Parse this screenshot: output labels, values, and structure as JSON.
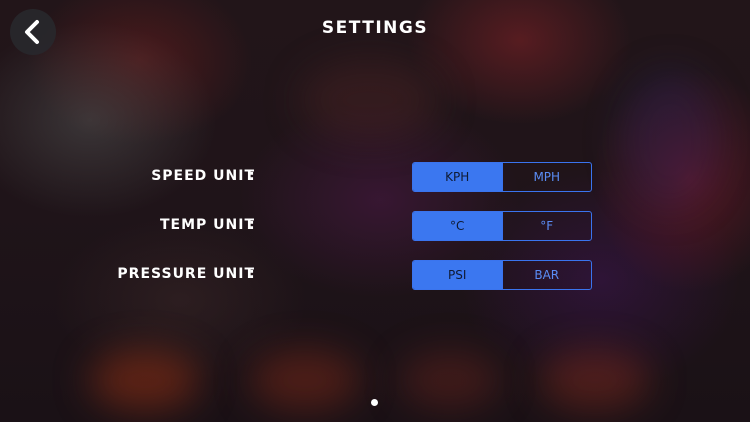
{
  "header": {
    "title": "SETTINGS",
    "back_icon": "chevron-left-icon"
  },
  "settings": {
    "colon": ":",
    "speed": {
      "label": "SPEED UNIT",
      "options": [
        "KPH",
        "MPH"
      ],
      "selected": "KPH"
    },
    "temp": {
      "label": "TEMP UNIT",
      "options": [
        "°C",
        "°F"
      ],
      "selected": "°C"
    },
    "pressure": {
      "label": "PRESSURE UNIT",
      "options": [
        "PSI",
        "BAR"
      ],
      "selected": "PSI"
    }
  },
  "pager": {
    "current_page": 1,
    "page_count": 1
  },
  "colors": {
    "accent": "#3b77f0",
    "accent_border": "#3a74ee",
    "text": "#ffffff"
  }
}
